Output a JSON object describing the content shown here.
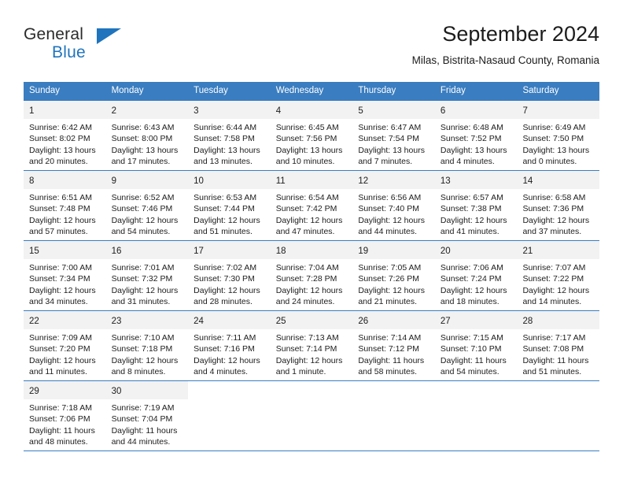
{
  "brand": {
    "name_part1": "General",
    "name_part2": "Blue",
    "accent_color": "#1f74bd"
  },
  "header": {
    "title": "September 2024",
    "subtitle": "Milas, Bistrita-Nasaud County, Romania"
  },
  "calendar": {
    "header_bg_color": "#3a7dc0",
    "daynum_band_color": "#f2f2f2",
    "weekdays": [
      "Sunday",
      "Monday",
      "Tuesday",
      "Wednesday",
      "Thursday",
      "Friday",
      "Saturday"
    ],
    "labels": {
      "sunrise": "Sunrise:",
      "sunset": "Sunset:",
      "daylight": "Daylight:"
    },
    "weeks": [
      [
        {
          "day": "1",
          "sunrise": "Sunrise: 6:42 AM",
          "sunset": "Sunset: 8:02 PM",
          "daylight_line1": "Daylight: 13 hours",
          "daylight_line2": "and 20 minutes."
        },
        {
          "day": "2",
          "sunrise": "Sunrise: 6:43 AM",
          "sunset": "Sunset: 8:00 PM",
          "daylight_line1": "Daylight: 13 hours",
          "daylight_line2": "and 17 minutes."
        },
        {
          "day": "3",
          "sunrise": "Sunrise: 6:44 AM",
          "sunset": "Sunset: 7:58 PM",
          "daylight_line1": "Daylight: 13 hours",
          "daylight_line2": "and 13 minutes."
        },
        {
          "day": "4",
          "sunrise": "Sunrise: 6:45 AM",
          "sunset": "Sunset: 7:56 PM",
          "daylight_line1": "Daylight: 13 hours",
          "daylight_line2": "and 10 minutes."
        },
        {
          "day": "5",
          "sunrise": "Sunrise: 6:47 AM",
          "sunset": "Sunset: 7:54 PM",
          "daylight_line1": "Daylight: 13 hours",
          "daylight_line2": "and 7 minutes."
        },
        {
          "day": "6",
          "sunrise": "Sunrise: 6:48 AM",
          "sunset": "Sunset: 7:52 PM",
          "daylight_line1": "Daylight: 13 hours",
          "daylight_line2": "and 4 minutes."
        },
        {
          "day": "7",
          "sunrise": "Sunrise: 6:49 AM",
          "sunset": "Sunset: 7:50 PM",
          "daylight_line1": "Daylight: 13 hours",
          "daylight_line2": "and 0 minutes."
        }
      ],
      [
        {
          "day": "8",
          "sunrise": "Sunrise: 6:51 AM",
          "sunset": "Sunset: 7:48 PM",
          "daylight_line1": "Daylight: 12 hours",
          "daylight_line2": "and 57 minutes."
        },
        {
          "day": "9",
          "sunrise": "Sunrise: 6:52 AM",
          "sunset": "Sunset: 7:46 PM",
          "daylight_line1": "Daylight: 12 hours",
          "daylight_line2": "and 54 minutes."
        },
        {
          "day": "10",
          "sunrise": "Sunrise: 6:53 AM",
          "sunset": "Sunset: 7:44 PM",
          "daylight_line1": "Daylight: 12 hours",
          "daylight_line2": "and 51 minutes."
        },
        {
          "day": "11",
          "sunrise": "Sunrise: 6:54 AM",
          "sunset": "Sunset: 7:42 PM",
          "daylight_line1": "Daylight: 12 hours",
          "daylight_line2": "and 47 minutes."
        },
        {
          "day": "12",
          "sunrise": "Sunrise: 6:56 AM",
          "sunset": "Sunset: 7:40 PM",
          "daylight_line1": "Daylight: 12 hours",
          "daylight_line2": "and 44 minutes."
        },
        {
          "day": "13",
          "sunrise": "Sunrise: 6:57 AM",
          "sunset": "Sunset: 7:38 PM",
          "daylight_line1": "Daylight: 12 hours",
          "daylight_line2": "and 41 minutes."
        },
        {
          "day": "14",
          "sunrise": "Sunrise: 6:58 AM",
          "sunset": "Sunset: 7:36 PM",
          "daylight_line1": "Daylight: 12 hours",
          "daylight_line2": "and 37 minutes."
        }
      ],
      [
        {
          "day": "15",
          "sunrise": "Sunrise: 7:00 AM",
          "sunset": "Sunset: 7:34 PM",
          "daylight_line1": "Daylight: 12 hours",
          "daylight_line2": "and 34 minutes."
        },
        {
          "day": "16",
          "sunrise": "Sunrise: 7:01 AM",
          "sunset": "Sunset: 7:32 PM",
          "daylight_line1": "Daylight: 12 hours",
          "daylight_line2": "and 31 minutes."
        },
        {
          "day": "17",
          "sunrise": "Sunrise: 7:02 AM",
          "sunset": "Sunset: 7:30 PM",
          "daylight_line1": "Daylight: 12 hours",
          "daylight_line2": "and 28 minutes."
        },
        {
          "day": "18",
          "sunrise": "Sunrise: 7:04 AM",
          "sunset": "Sunset: 7:28 PM",
          "daylight_line1": "Daylight: 12 hours",
          "daylight_line2": "and 24 minutes."
        },
        {
          "day": "19",
          "sunrise": "Sunrise: 7:05 AM",
          "sunset": "Sunset: 7:26 PM",
          "daylight_line1": "Daylight: 12 hours",
          "daylight_line2": "and 21 minutes."
        },
        {
          "day": "20",
          "sunrise": "Sunrise: 7:06 AM",
          "sunset": "Sunset: 7:24 PM",
          "daylight_line1": "Daylight: 12 hours",
          "daylight_line2": "and 18 minutes."
        },
        {
          "day": "21",
          "sunrise": "Sunrise: 7:07 AM",
          "sunset": "Sunset: 7:22 PM",
          "daylight_line1": "Daylight: 12 hours",
          "daylight_line2": "and 14 minutes."
        }
      ],
      [
        {
          "day": "22",
          "sunrise": "Sunrise: 7:09 AM",
          "sunset": "Sunset: 7:20 PM",
          "daylight_line1": "Daylight: 12 hours",
          "daylight_line2": "and 11 minutes."
        },
        {
          "day": "23",
          "sunrise": "Sunrise: 7:10 AM",
          "sunset": "Sunset: 7:18 PM",
          "daylight_line1": "Daylight: 12 hours",
          "daylight_line2": "and 8 minutes."
        },
        {
          "day": "24",
          "sunrise": "Sunrise: 7:11 AM",
          "sunset": "Sunset: 7:16 PM",
          "daylight_line1": "Daylight: 12 hours",
          "daylight_line2": "and 4 minutes."
        },
        {
          "day": "25",
          "sunrise": "Sunrise: 7:13 AM",
          "sunset": "Sunset: 7:14 PM",
          "daylight_line1": "Daylight: 12 hours",
          "daylight_line2": "and 1 minute."
        },
        {
          "day": "26",
          "sunrise": "Sunrise: 7:14 AM",
          "sunset": "Sunset: 7:12 PM",
          "daylight_line1": "Daylight: 11 hours",
          "daylight_line2": "and 58 minutes."
        },
        {
          "day": "27",
          "sunrise": "Sunrise: 7:15 AM",
          "sunset": "Sunset: 7:10 PM",
          "daylight_line1": "Daylight: 11 hours",
          "daylight_line2": "and 54 minutes."
        },
        {
          "day": "28",
          "sunrise": "Sunrise: 7:17 AM",
          "sunset": "Sunset: 7:08 PM",
          "daylight_line1": "Daylight: 11 hours",
          "daylight_line2": "and 51 minutes."
        }
      ],
      [
        {
          "day": "29",
          "sunrise": "Sunrise: 7:18 AM",
          "sunset": "Sunset: 7:06 PM",
          "daylight_line1": "Daylight: 11 hours",
          "daylight_line2": "and 48 minutes."
        },
        {
          "day": "30",
          "sunrise": "Sunrise: 7:19 AM",
          "sunset": "Sunset: 7:04 PM",
          "daylight_line1": "Daylight: 11 hours",
          "daylight_line2": "and 44 minutes."
        },
        {
          "day": "",
          "sunrise": "",
          "sunset": "",
          "daylight_line1": "",
          "daylight_line2": ""
        },
        {
          "day": "",
          "sunrise": "",
          "sunset": "",
          "daylight_line1": "",
          "daylight_line2": ""
        },
        {
          "day": "",
          "sunrise": "",
          "sunset": "",
          "daylight_line1": "",
          "daylight_line2": ""
        },
        {
          "day": "",
          "sunrise": "",
          "sunset": "",
          "daylight_line1": "",
          "daylight_line2": ""
        },
        {
          "day": "",
          "sunrise": "",
          "sunset": "",
          "daylight_line1": "",
          "daylight_line2": ""
        }
      ]
    ]
  }
}
